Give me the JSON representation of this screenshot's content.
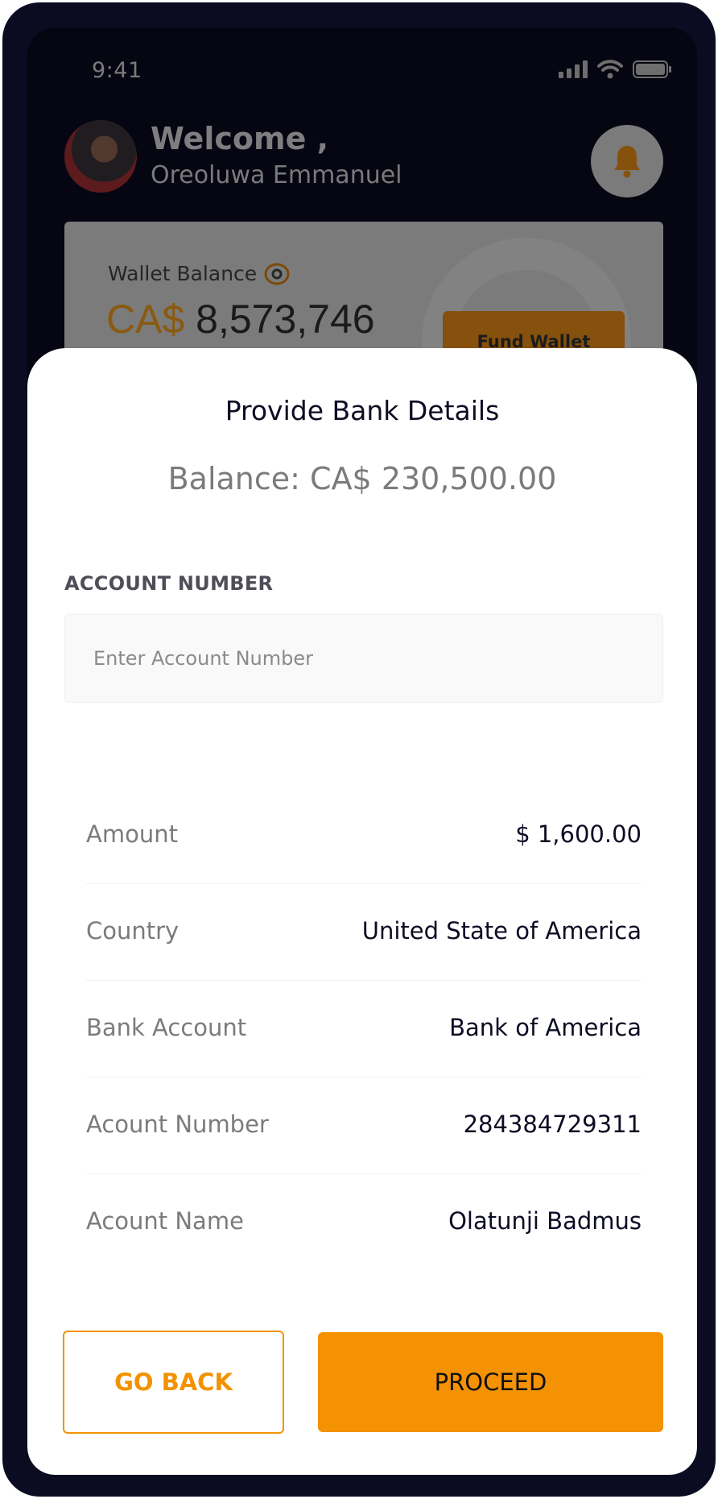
{
  "status_bar": {
    "time": "9:41"
  },
  "header": {
    "welcome": "Welcome ,",
    "user_name": "Oreoluwa Emmanuel"
  },
  "wallet": {
    "label": "Wallet Balance",
    "currency": "CA$",
    "amount": "8,573,746",
    "fund_button": "Fund Wallet"
  },
  "sheet": {
    "title": "Provide Bank Details",
    "balance": "Balance: CA$ 230,500.00",
    "account_label": "ACCOUNT NUMBER",
    "account_placeholder": "Enter Account Number",
    "details": [
      {
        "label": "Amount",
        "value": "$ 1,600.00"
      },
      {
        "label": "Country",
        "value": "United State of America"
      },
      {
        "label": "Bank Account",
        "value": "Bank of America"
      },
      {
        "label": "Acount Number",
        "value": "284384729311"
      },
      {
        "label": "Acount Name",
        "value": "Olatunji Badmus"
      }
    ],
    "go_back_label": "GO BACK",
    "proceed_label": "PROCEED"
  },
  "colors": {
    "accent": "#f49204",
    "device_frame": "#0b0b22",
    "text_dark": "#0c0c24",
    "text_muted": "#7b7b7b"
  }
}
